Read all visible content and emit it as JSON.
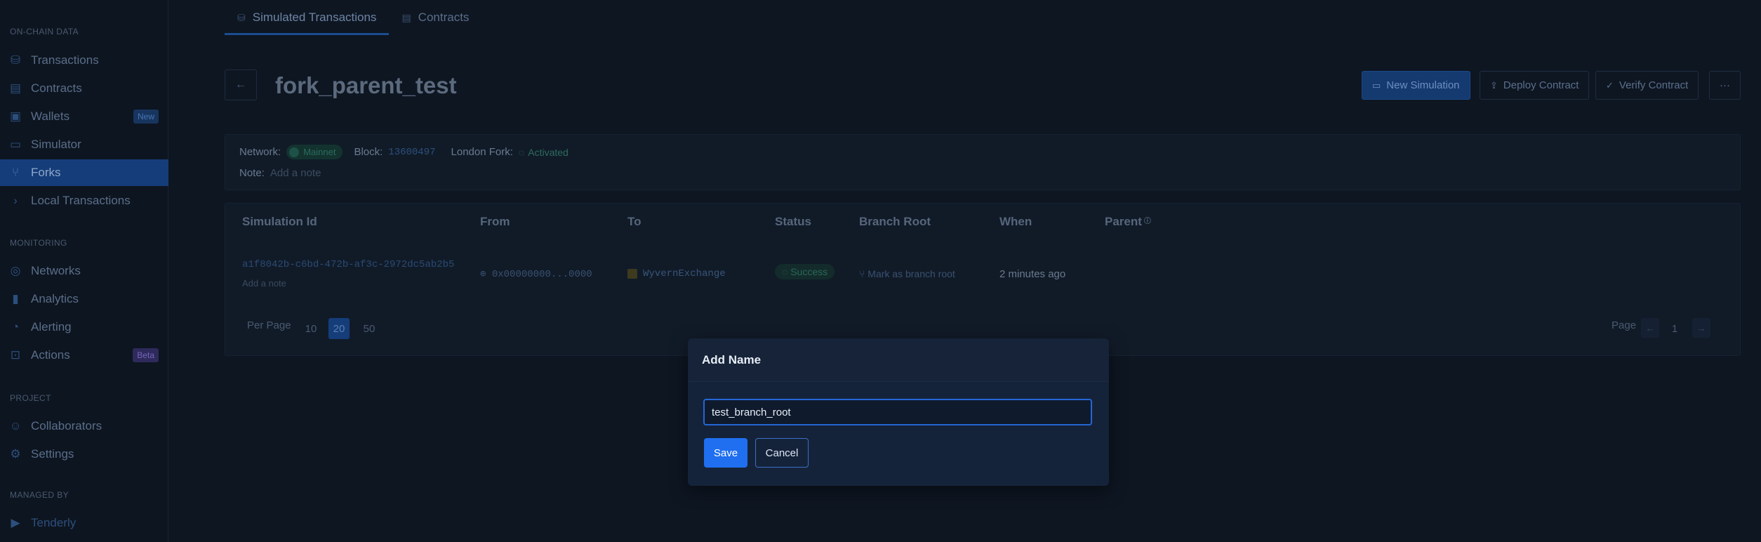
{
  "sidebar": {
    "sections": {
      "onchain": "ON-CHAIN DATA",
      "monitoring": "MONITORING",
      "project": "PROJECT",
      "managed_by": "MANAGED BY"
    },
    "items": {
      "transactions": "Transactions",
      "contracts": "Contracts",
      "wallets": "Wallets",
      "wallets_badge": "New",
      "simulator": "Simulator",
      "forks": "Forks",
      "local_transactions": "Local Transactions",
      "networks": "Networks",
      "analytics": "Analytics",
      "alerting": "Alerting",
      "actions": "Actions",
      "actions_badge": "Beta",
      "collaborators": "Collaborators",
      "settings": "Settings",
      "tenderly": "Tenderly"
    }
  },
  "tabs": {
    "simulated": "Simulated Transactions",
    "contracts": "Contracts"
  },
  "header": {
    "title": "fork_parent_test",
    "new_simulation": "New Simulation",
    "deploy_contract": "Deploy Contract",
    "verify_contract": "Verify Contract",
    "more": "···"
  },
  "info": {
    "network_label": "Network:",
    "network_value": "Mainnet",
    "block_label": "Block:",
    "block_value": "13600497",
    "london_label": "London Fork:",
    "london_value": "Activated",
    "note_label": "Note:",
    "note_placeholder": "Add a note"
  },
  "table": {
    "headers": {
      "sim_id": "Simulation Id",
      "from": "From",
      "to": "To",
      "status": "Status",
      "branch_root": "Branch Root",
      "when": "When",
      "parent": "Parent"
    },
    "row": {
      "sim_id": "a1f8042b-c6bd-472b-af3c-2972dc5ab2b5",
      "note": "Add a note",
      "from": "0x00000000...0000",
      "to": "WyvernExchange",
      "status": "Success",
      "branch": "Mark as branch root",
      "when": "2 minutes ago"
    },
    "pagination": {
      "per_page_label": "Per Page",
      "opt10": "10",
      "opt20": "20",
      "opt50": "50",
      "page_label": "Page",
      "page": "1"
    }
  },
  "modal": {
    "title": "Add Name",
    "input_value": "test_branch_root",
    "save": "Save",
    "cancel": "Cancel"
  }
}
